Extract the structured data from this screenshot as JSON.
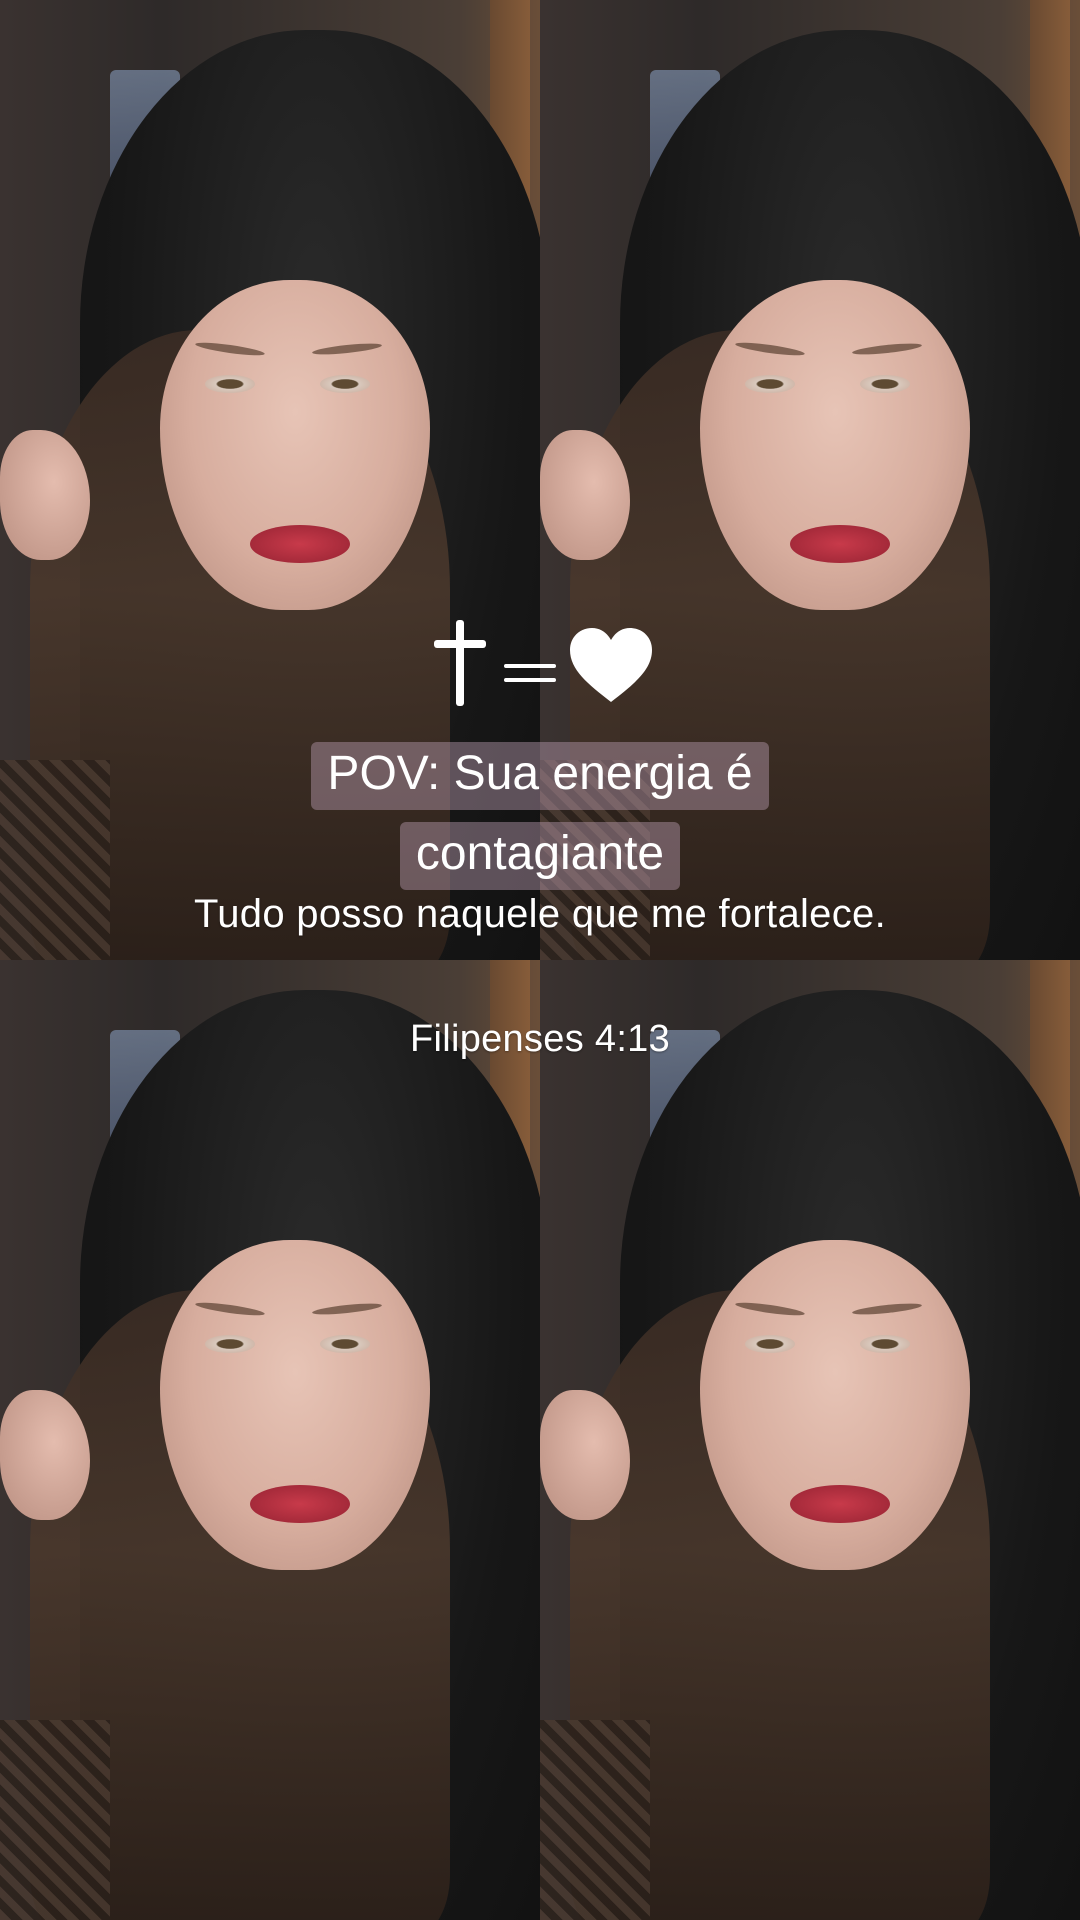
{
  "overlay": {
    "pov_line1": "POV: Sua energia é",
    "pov_line2": "contagiante",
    "verse": "Tudo posso naquele que me fortalece.",
    "reference": "Filipenses 4:13",
    "symbols": {
      "cross": "cross-icon",
      "equals": "equals-icon",
      "heart": "heart-icon"
    }
  },
  "photo_grid": {
    "tiles": 4,
    "layout": "2x2 repeated selfie photo"
  },
  "colors": {
    "text": "#ffffff",
    "caption_bg": "#b99baf"
  }
}
